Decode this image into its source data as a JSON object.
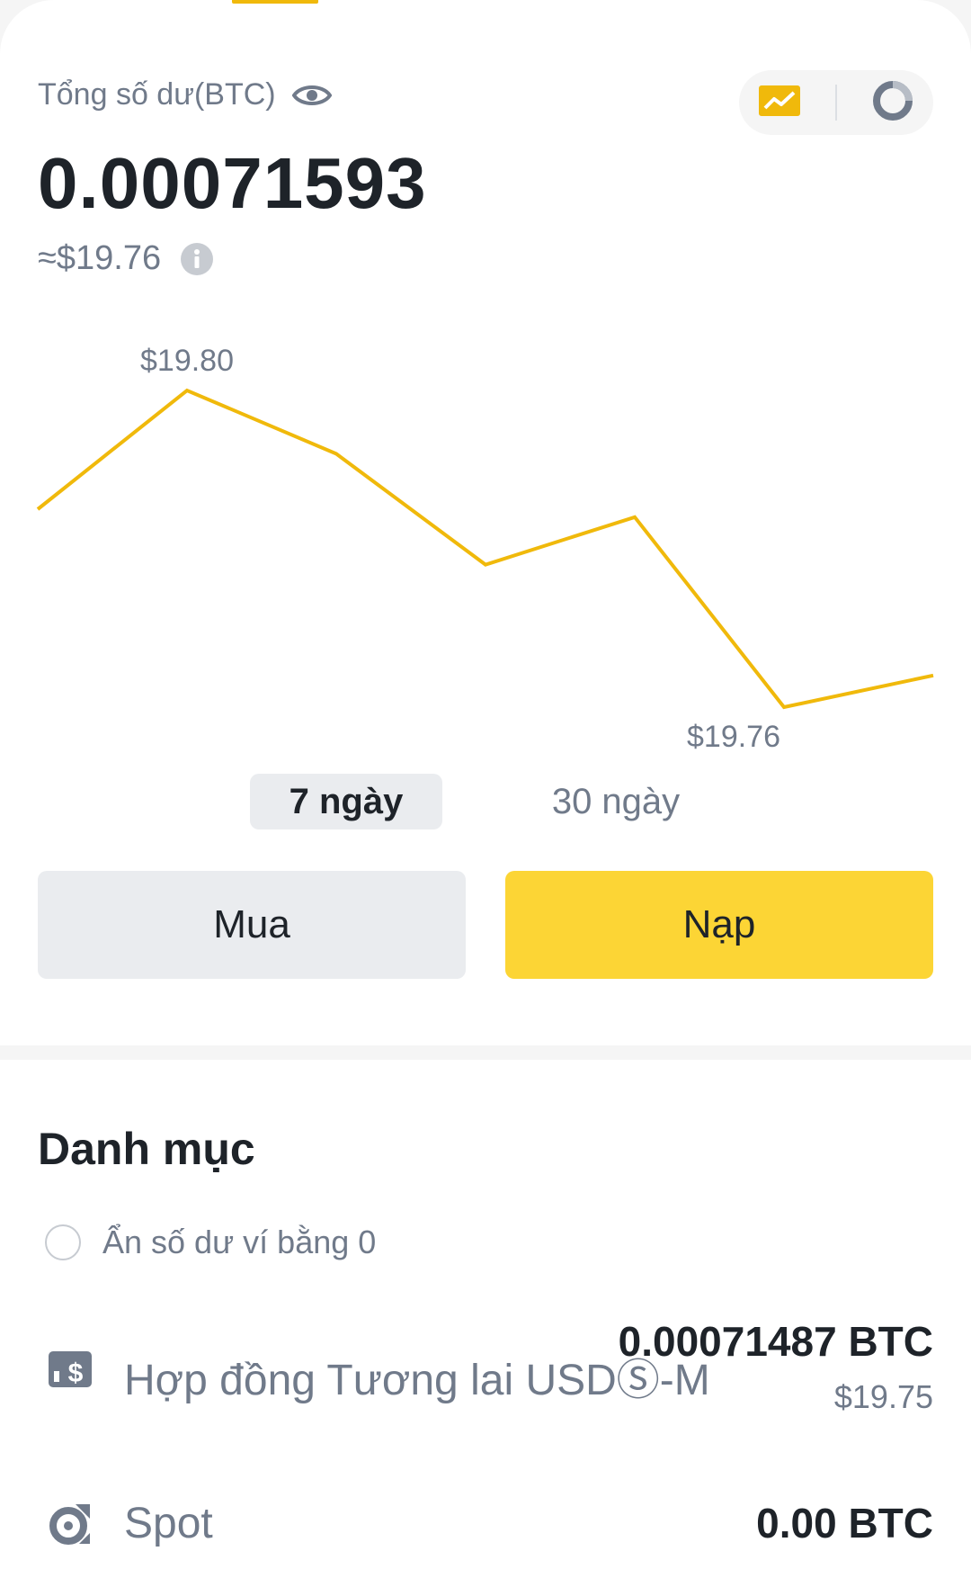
{
  "balance": {
    "label": "Tổng số dư(BTC)",
    "value": "0.00071593",
    "usd": "≈$19.76"
  },
  "icons": {
    "eye": "eye-icon",
    "info": "info-icon",
    "chart_view": "line-chart-icon",
    "pie_view": "pie-chart-icon",
    "futures": "futures-dollar-icon",
    "spot": "spot-icon"
  },
  "colors": {
    "accent": "#f0b90b",
    "deposit": "#fcd535",
    "line": "#f0b90b"
  },
  "chart_data": {
    "type": "line",
    "series": [
      {
        "values": [
          19.785,
          19.8,
          19.792,
          19.778,
          19.784,
          19.76,
          19.764
        ]
      }
    ],
    "annotations": {
      "max_label": "$19.80",
      "min_label": "$19.76"
    },
    "ylim": [
      19.755,
      19.805
    ]
  },
  "range_tabs": [
    {
      "label": "7 ngày",
      "active": true
    },
    {
      "label": "30 ngày",
      "active": false
    }
  ],
  "actions": {
    "buy": "Mua",
    "deposit": "Nạp"
  },
  "portfolio": {
    "title": "Danh mục",
    "hide_zero_label": "Ẩn số dư ví bằng 0",
    "assets": [
      {
        "name": "Hợp đồng Tương lai USDⓈ-M",
        "amount": "0.00071487 BTC",
        "usd": "$19.75"
      },
      {
        "name": "Spot",
        "amount": "0.00 BTC",
        "usd": ""
      }
    ]
  }
}
